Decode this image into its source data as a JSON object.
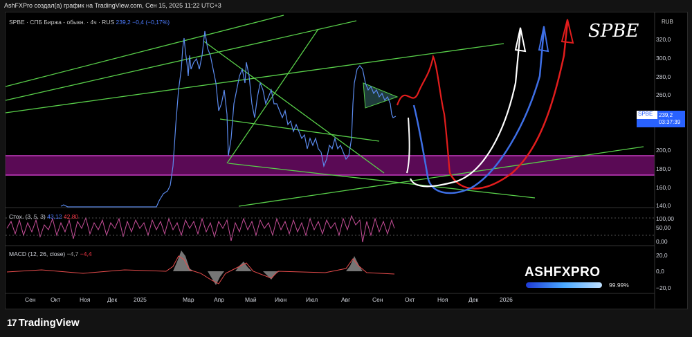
{
  "header": {
    "caption": "AshFXPro создал(а) график на TradingView.com, Сен 15, 2025 11:22 UTC+3"
  },
  "symbol_line": {
    "text": "SPBE · СПБ Биржа - обыкн. · 4ч · RUS",
    "price": "239,2",
    "change": "−0,4 (−0,17%)"
  },
  "title": "SPBE",
  "currency": "RUB",
  "price_axis": [
    "320,0",
    "300,0",
    "280,0",
    "260,0",
    "200,0",
    "180,0",
    "160,0",
    "140,0"
  ],
  "price_badge": {
    "symbol": "SPBE",
    "price": "239,2",
    "countdown": "03:37:39"
  },
  "stoch": {
    "label": "Стох. (3, 5, 3)",
    "k": "43,12",
    "d": "42,80",
    "axis": [
      "100,00",
      "50,00",
      "0,00"
    ]
  },
  "macd": {
    "label": "MACD (12, 26, close)",
    "macd": "−4,7",
    "signal": "−4,4",
    "axis": [
      "20,0",
      "0,0",
      "−20,0"
    ]
  },
  "time_axis": [
    "Сен",
    "Окт",
    "Ноя",
    "Дек",
    "2025",
    "Мар",
    "Апр",
    "Май",
    "Июн",
    "Июл",
    "Авг",
    "Сен",
    "Окт",
    "Ноя",
    "Дек",
    "2026"
  ],
  "watermark": {
    "brand": "ASHFXPRO",
    "percent": "99.99%"
  },
  "footer": {
    "logo": "TradingView"
  },
  "colors": {
    "price_line": "#5b8bef",
    "trendline": "#59d04a",
    "zone": "#5a0a55",
    "badge": "#2962ff",
    "arrow_red": "#e21d1d",
    "arrow_blue": "#3e6fe6",
    "arrow_white": "#ffffff"
  }
}
